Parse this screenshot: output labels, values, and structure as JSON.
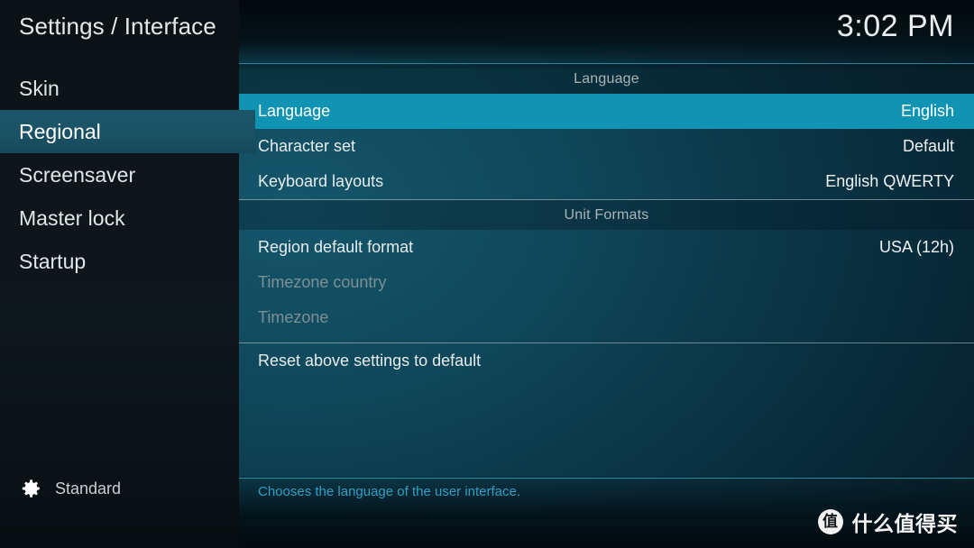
{
  "header": {
    "title": "Settings / Interface",
    "clock": "3:02 PM"
  },
  "sidebar": {
    "items": [
      {
        "label": "Skin",
        "selected": false
      },
      {
        "label": "Regional",
        "selected": true
      },
      {
        "label": "Screensaver",
        "selected": false
      },
      {
        "label": "Master lock",
        "selected": false
      },
      {
        "label": "Startup",
        "selected": false
      }
    ],
    "level": {
      "icon": "gear-icon",
      "label": "Standard"
    }
  },
  "main": {
    "groups": [
      {
        "header": "Language",
        "rows": [
          {
            "label": "Language",
            "value": "English",
            "selected": true,
            "disabled": false
          },
          {
            "label": "Character set",
            "value": "Default",
            "selected": false,
            "disabled": false
          },
          {
            "label": "Keyboard layouts",
            "value": "English QWERTY",
            "selected": false,
            "disabled": false
          }
        ]
      },
      {
        "header": "Unit Formats",
        "rows": [
          {
            "label": "Region default format",
            "value": "USA (12h)",
            "selected": false,
            "disabled": false
          },
          {
            "label": "Timezone country",
            "value": "",
            "selected": false,
            "disabled": true
          },
          {
            "label": "Timezone",
            "value": "",
            "selected": false,
            "disabled": true
          }
        ]
      },
      {
        "header": "",
        "rows": [
          {
            "label": "Reset above settings to default",
            "value": "",
            "selected": false,
            "disabled": false
          }
        ]
      }
    ]
  },
  "footer": {
    "help": "Chooses the language of the user interface."
  },
  "watermark": {
    "logo": "值",
    "text": "什么值得买"
  },
  "colors": {
    "accent": "#1193b4",
    "sidebar_selected": "#1a5568",
    "rule": "#2f93ad",
    "help_text": "#2f9fc2",
    "disabled_text": "#7d8f93"
  }
}
